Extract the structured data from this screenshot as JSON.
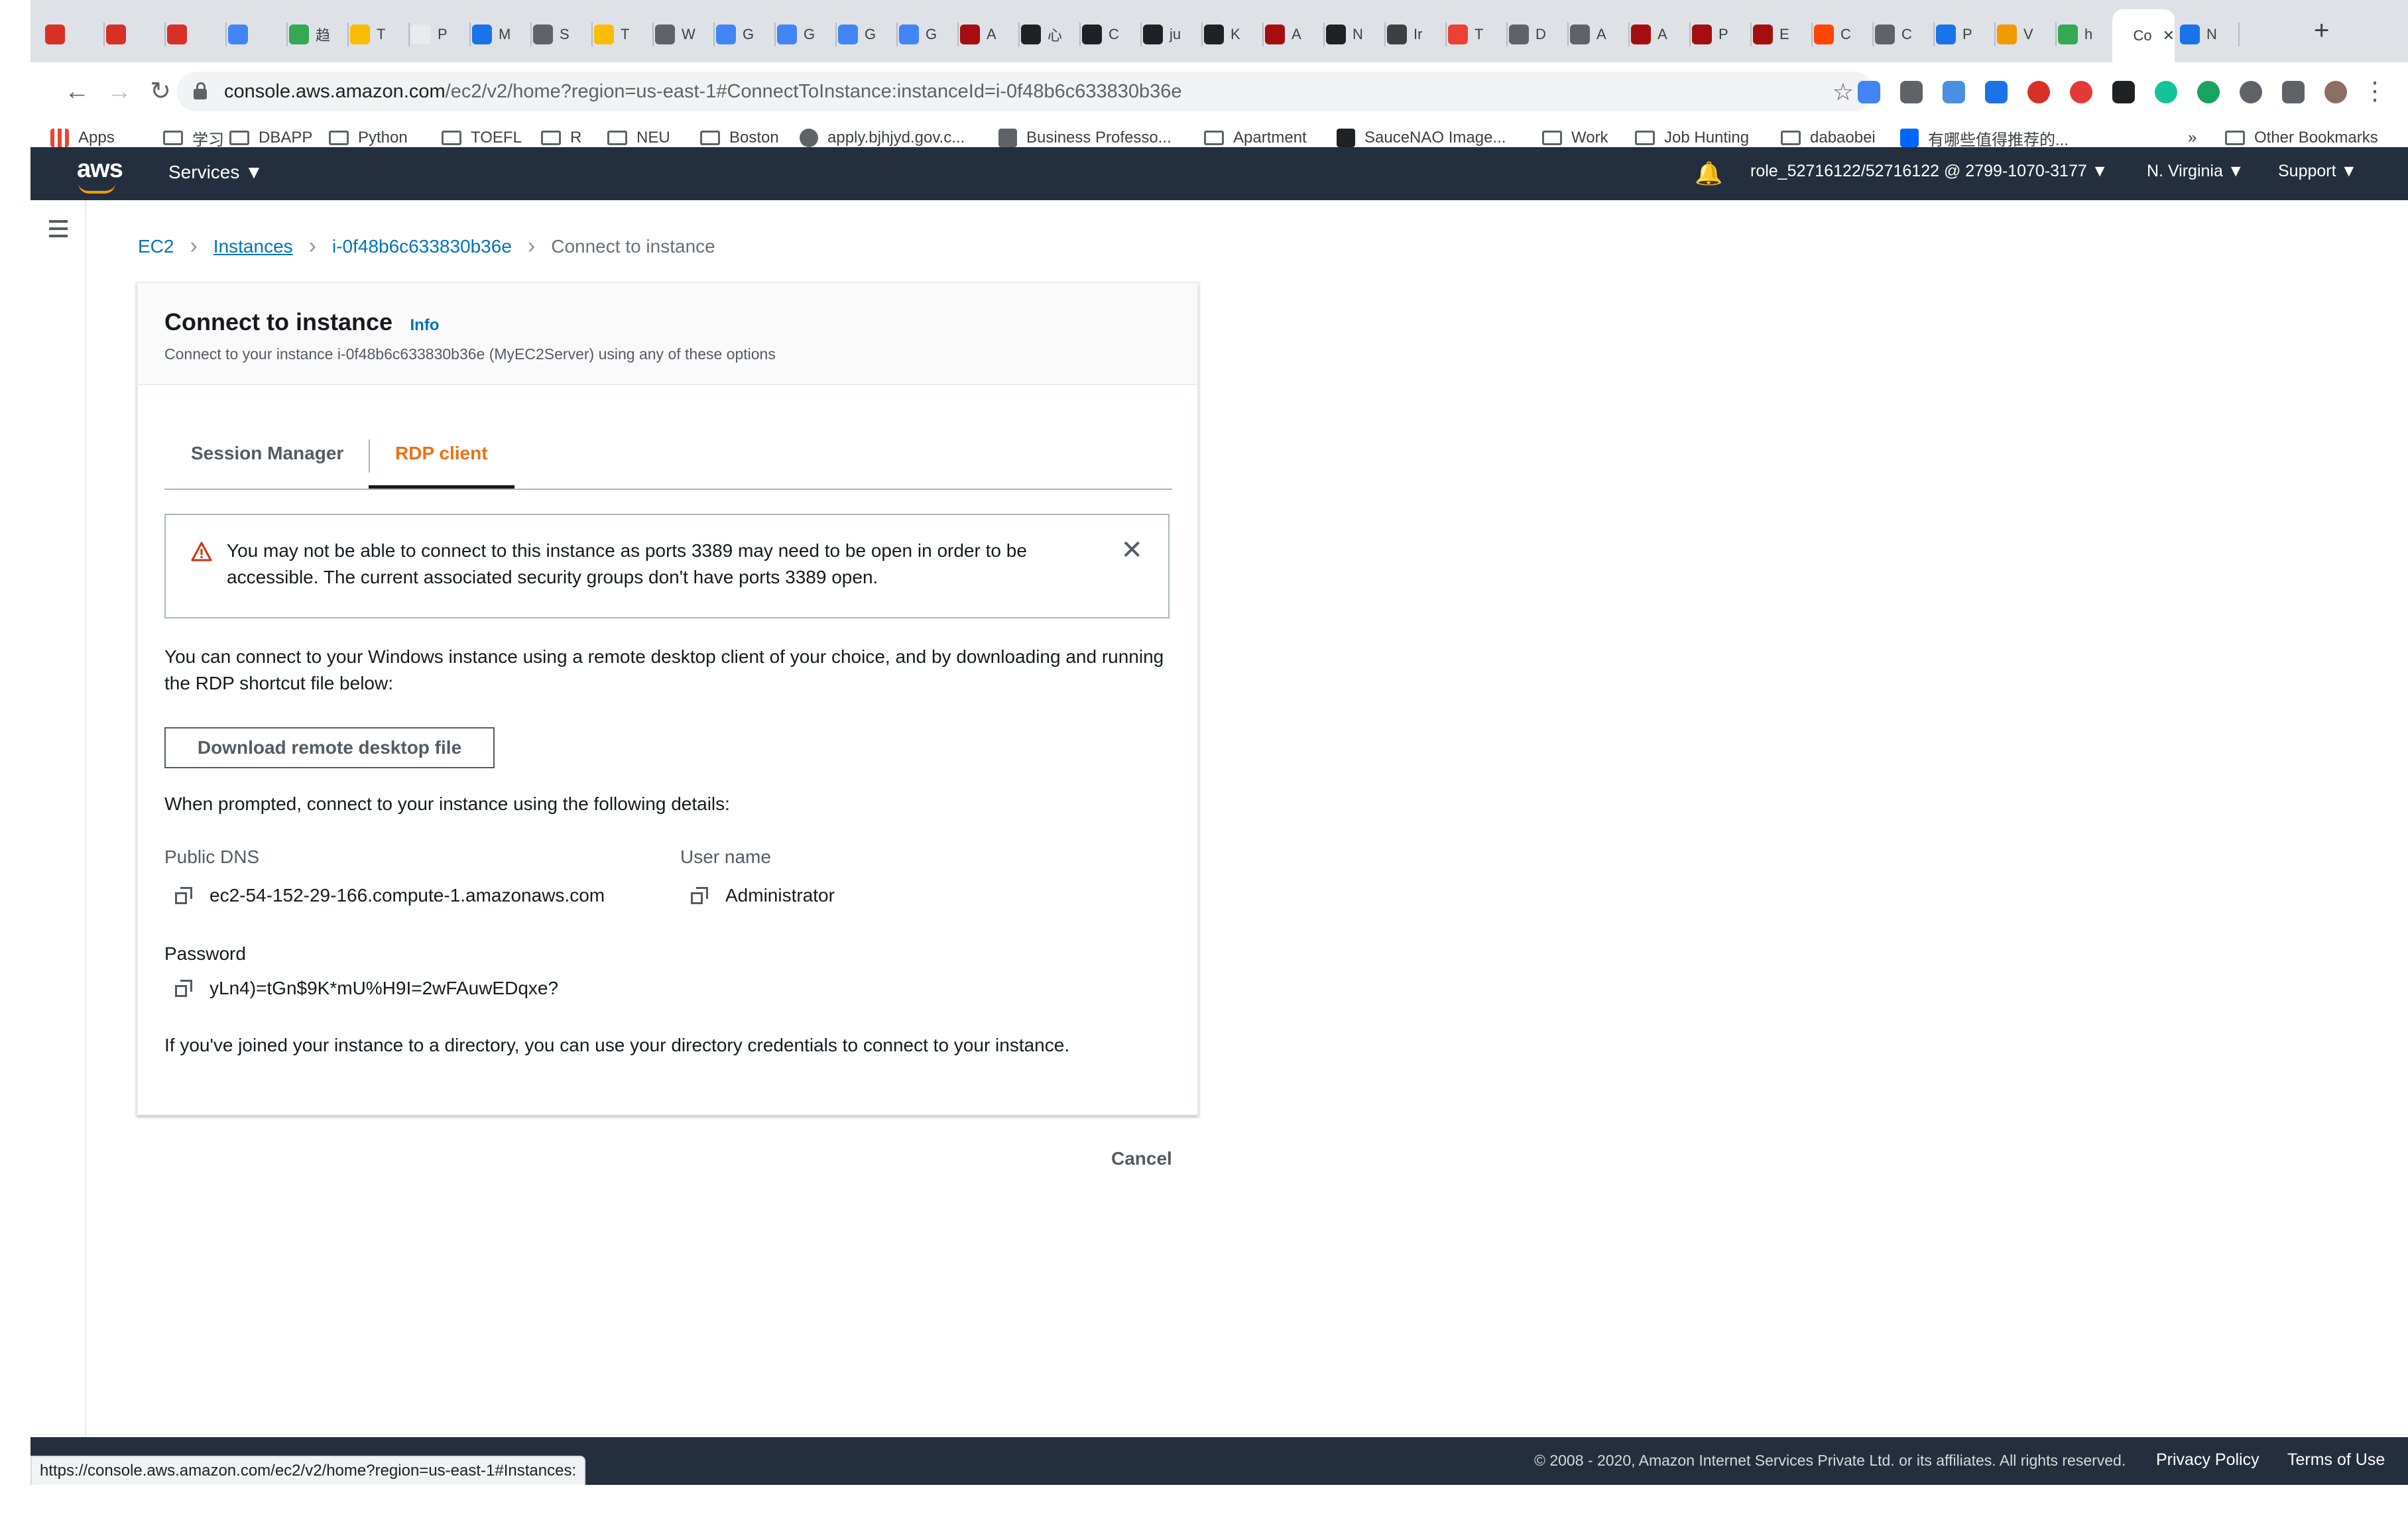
{
  "browser": {
    "tabs": [
      {
        "label": "",
        "color": "#d93025"
      },
      {
        "label": "",
        "color": "#d93025"
      },
      {
        "label": "",
        "color": "#d93025"
      },
      {
        "label": "",
        "color": "#4285f4"
      },
      {
        "label": "趋",
        "color": "#34a853"
      },
      {
        "label": "T",
        "color": "#fbbc05"
      },
      {
        "label": "P",
        "color": "#e8eaed"
      },
      {
        "label": "M",
        "color": "#1a73e8"
      },
      {
        "label": "S",
        "color": "#5f6368"
      },
      {
        "label": "T",
        "color": "#fbbc05"
      },
      {
        "label": "W",
        "color": "#5f6368"
      },
      {
        "label": "G",
        "color": "#4285f4"
      },
      {
        "label": "G",
        "color": "#4285f4"
      },
      {
        "label": "G",
        "color": "#4285f4"
      },
      {
        "label": "G",
        "color": "#4285f4"
      },
      {
        "label": "A",
        "color": "#a50e0e"
      },
      {
        "label": "心",
        "color": "#202124"
      },
      {
        "label": "C",
        "color": "#202124"
      },
      {
        "label": "ju",
        "color": "#202124"
      },
      {
        "label": "K",
        "color": "#202124"
      },
      {
        "label": "A",
        "color": "#a50e0e"
      },
      {
        "label": "N",
        "color": "#202124"
      },
      {
        "label": "Ir",
        "color": "#3c4043"
      },
      {
        "label": "T",
        "color": "#ea4335"
      },
      {
        "label": "D",
        "color": "#5f6368"
      },
      {
        "label": "A",
        "color": "#5f6368"
      },
      {
        "label": "A",
        "color": "#a50e0e"
      },
      {
        "label": "P",
        "color": "#a50e0e"
      },
      {
        "label": "E",
        "color": "#a50e0e"
      },
      {
        "label": "C",
        "color": "#ff4500"
      },
      {
        "label": "C",
        "color": "#5f6368"
      },
      {
        "label": "P",
        "color": "#1a73e8"
      },
      {
        "label": "V",
        "color": "#f29900"
      },
      {
        "label": "h",
        "color": "#34a853"
      },
      {
        "label": "Co",
        "color": "#ffffff"
      },
      {
        "label": "N",
        "color": "#1a73e8"
      }
    ],
    "url_host": "console.aws.amazon.com",
    "url_path": "/ec2/v2/home?region=us-east-1#ConnectToInstance:instanceId=i-0f48b6c633830b36e",
    "bookmarks": [
      {
        "label": "Apps",
        "icon": "apps-grid-icon"
      },
      {
        "label": "学习",
        "icon": "folder-icon"
      },
      {
        "label": "DBAPP",
        "icon": "folder-icon"
      },
      {
        "label": "Python",
        "icon": "folder-icon"
      },
      {
        "label": "TOEFL",
        "icon": "folder-icon"
      },
      {
        "label": "R",
        "icon": "folder-icon"
      },
      {
        "label": "NEU",
        "icon": "folder-icon"
      },
      {
        "label": "Boston",
        "icon": "folder-icon"
      },
      {
        "label": "apply.bjhjyd.gov.c...",
        "icon": "globe-icon"
      },
      {
        "label": "Business Professo...",
        "icon": "person-icon"
      },
      {
        "label": "Apartment",
        "icon": "folder-icon"
      },
      {
        "label": "SauceNAO Image...",
        "icon": "saucenao-icon"
      },
      {
        "label": "Work",
        "icon": "folder-icon"
      },
      {
        "label": "Job Hunting",
        "icon": "folder-icon"
      },
      {
        "label": "dabaobei",
        "icon": "folder-icon"
      },
      {
        "label": "有哪些值得推荐的...",
        "icon": "zhihu-icon"
      }
    ],
    "bookmarks_overflow": "»",
    "other_bookmarks": "Other Bookmarks",
    "status_url": "https://console.aws.amazon.com/ec2/v2/home?region=us-east-1#Instances:"
  },
  "aws_header": {
    "logo": "aws",
    "services": "Services ▼",
    "account": "role_52716122/52716122 @ 2799-1070-3177 ▼",
    "region": "N. Virginia ▼",
    "support": "Support ▼"
  },
  "breadcrumb": {
    "ec2": "EC2",
    "instances": "Instances",
    "instance_id": "i-0f48b6c633830b36e",
    "current": "Connect to instance"
  },
  "card": {
    "title": "Connect to instance",
    "info": "Info",
    "subtitle": "Connect to your instance i-0f48b6c633830b36e (MyEC2Server) using any of these options",
    "tabs": [
      "Session Manager",
      "RDP client"
    ],
    "alert": "You may not be able to connect to this instance as ports 3389 may need to be open in order to be accessible. The current associated security groups don't have ports 3389 open.",
    "intro": "You can connect to your Windows instance using a remote desktop client of your choice, and by downloading and running the RDP shortcut file below:",
    "download_btn": "Download remote desktop file",
    "prompt": "When prompted, connect to your instance using the following details:",
    "public_dns_label": "Public DNS",
    "public_dns": "ec2-54-152-29-166.compute-1.amazonaws.com",
    "username_label": "User name",
    "username": "Administrator",
    "password_label": "Password",
    "password": "yLn4)=tGn$9K*mU%H9I=2wFAuwEDqxe?",
    "directory_note": "If you've joined your instance to a directory, you can use your directory credentials to connect to your instance."
  },
  "cancel": "Cancel",
  "footer": {
    "copyright": "© 2008 - 2020, Amazon Internet Services Private Ltd. or its affiliates. All rights reserved.",
    "privacy": "Privacy Policy",
    "terms": "Terms of Use"
  },
  "colors": {
    "accent": "#ec7211",
    "link": "#0073bb",
    "nav": "#232f3e",
    "warning": "#d13212"
  }
}
